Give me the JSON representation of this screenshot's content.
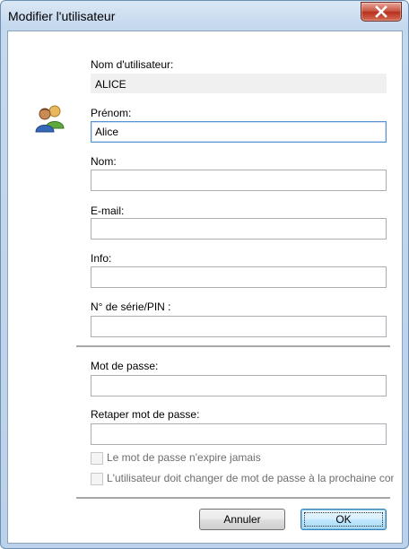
{
  "window": {
    "title": "Modifier l'utilisateur"
  },
  "form": {
    "username_label": "Nom d'utilisateur:",
    "username_value": "ALICE",
    "firstname_label": "Prénom:",
    "firstname_value": "Alice",
    "lastname_label": "Nom:",
    "lastname_value": "",
    "email_label": "E-mail:",
    "email_value": "",
    "info_label": "Info:",
    "info_value": "",
    "serial_label": "N° de série/PIN :",
    "serial_value": "",
    "password_label": "Mot de passe:",
    "password_value": "",
    "password_confirm_label": "Retaper mot de passe:",
    "password_confirm_value": "",
    "never_expires_label": "Le mot de passe n'expire jamais",
    "must_change_label": "L'utilisateur doit changer de mot de passe à la prochaine connexion"
  },
  "buttons": {
    "cancel_label": "Annuler",
    "ok_label": "OK"
  },
  "icons": {
    "close": "close-icon",
    "users": "users-icon"
  }
}
